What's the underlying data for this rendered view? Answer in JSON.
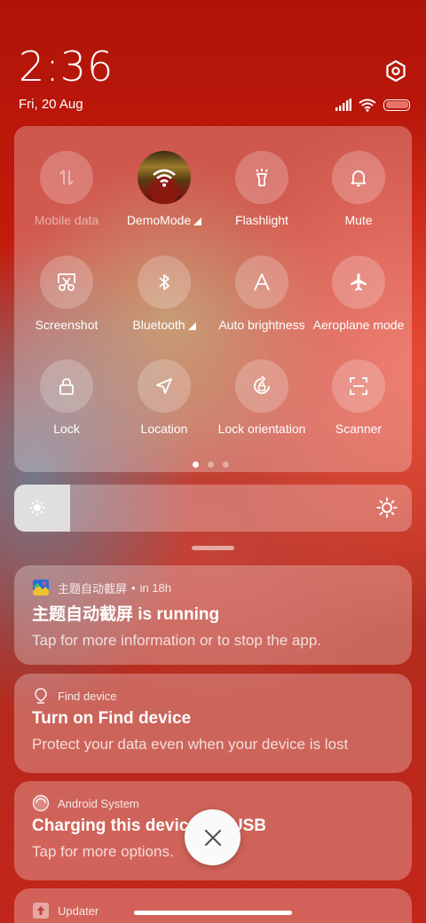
{
  "status": {
    "time": "2:36",
    "date": "Fri, 20 Aug",
    "battery_level_percent": 100,
    "battery_color": "#e8736b"
  },
  "quick_settings": {
    "tiles": [
      {
        "label": "Mobile data",
        "icon": "mobile-data-icon",
        "state": "disabled"
      },
      {
        "label": "DemoMode",
        "icon": "wifi-icon",
        "state": "on",
        "expandable": true
      },
      {
        "label": "Flashlight",
        "icon": "flashlight-icon",
        "state": "off"
      },
      {
        "label": "Mute",
        "icon": "bell-icon",
        "state": "off"
      },
      {
        "label": "Screenshot",
        "icon": "screenshot-icon",
        "state": "off"
      },
      {
        "label": "Bluetooth",
        "icon": "bluetooth-icon",
        "state": "off",
        "expandable": true
      },
      {
        "label": "Auto brightness",
        "icon": "auto-brightness-icon",
        "state": "off"
      },
      {
        "label": "Aeroplane mode",
        "icon": "airplane-icon",
        "state": "off"
      },
      {
        "label": "Lock",
        "icon": "lock-icon",
        "state": "off"
      },
      {
        "label": "Location",
        "icon": "location-icon",
        "state": "off"
      },
      {
        "label": "Lock orientation",
        "icon": "lock-orientation-icon",
        "state": "off"
      },
      {
        "label": "Scanner",
        "icon": "scanner-icon",
        "state": "off"
      }
    ],
    "page_count": 3,
    "current_page": 1
  },
  "brightness": {
    "level_fraction": 0.14
  },
  "notifications": [
    {
      "app": "主题自动截屏",
      "time": "in 18h",
      "title": "主题自动截屏 is running",
      "body": "Tap for more information or to stop the app.",
      "icon": "theme-app-icon"
    },
    {
      "app": "Find device",
      "title": "Turn on Find device",
      "body": "Protect your data even when your device is lost",
      "icon": "find-device-icon"
    },
    {
      "app": "Android System",
      "title": "Charging this device via USB",
      "body": "Tap for more options.",
      "icon": "android-system-icon"
    },
    {
      "app": "Updater",
      "icon": "updater-icon"
    }
  ],
  "clear_button": {
    "icon": "close-icon"
  }
}
